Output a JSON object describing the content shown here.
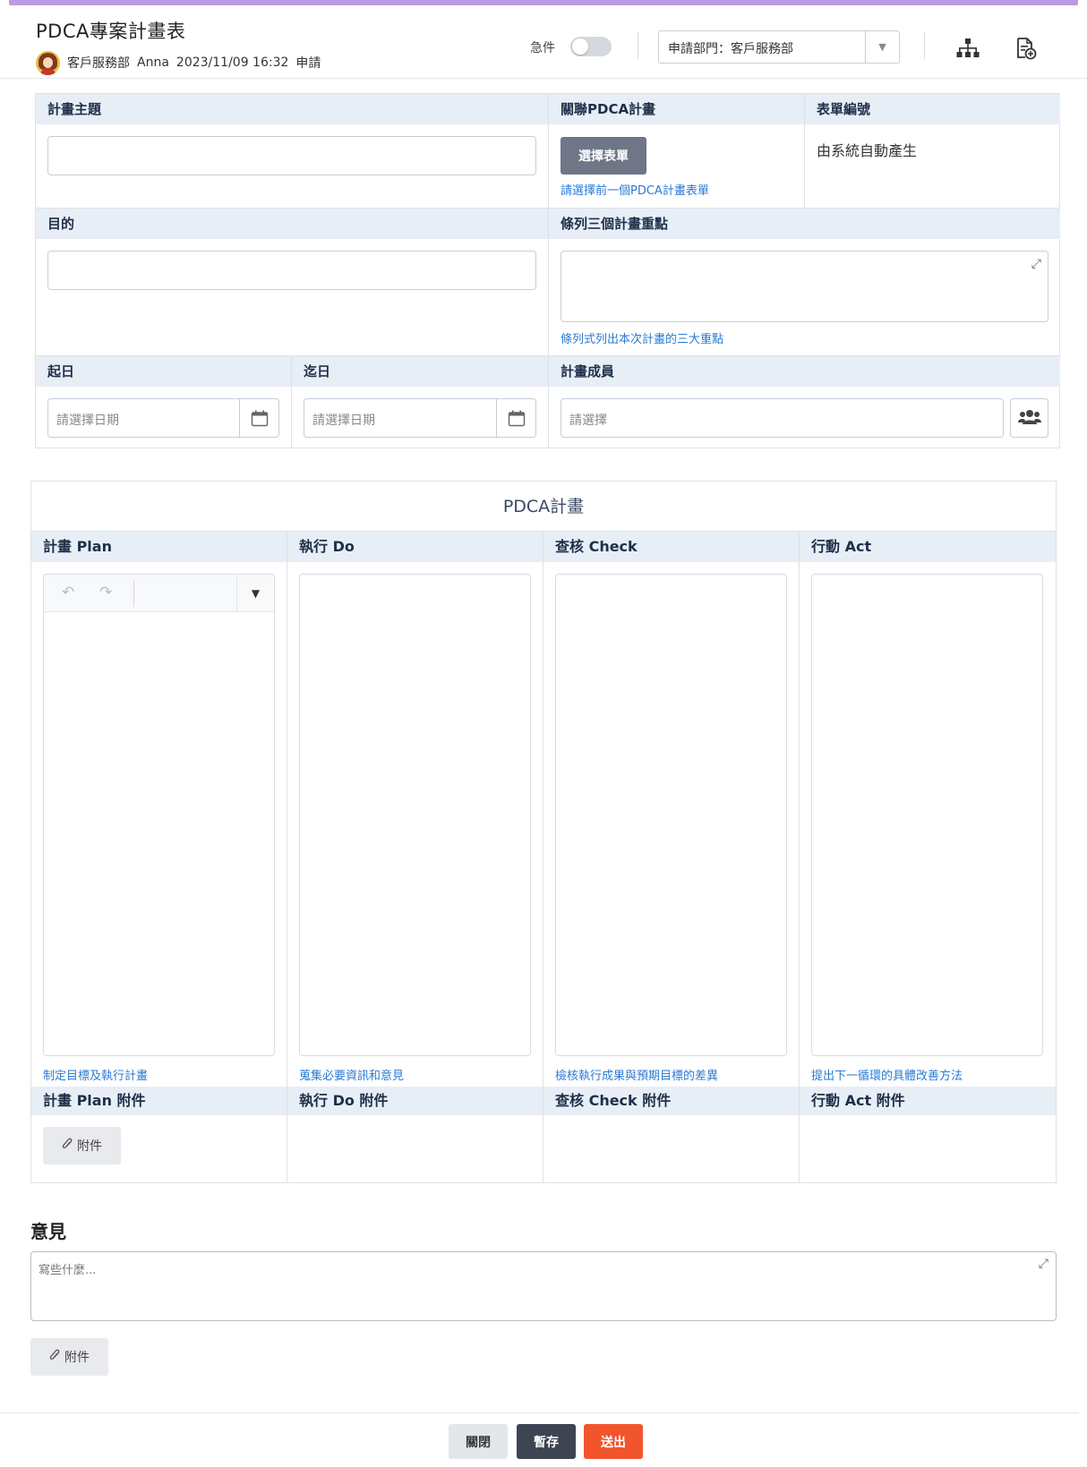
{
  "header": {
    "title": "PDCA專案計畫表",
    "applicant_dept": "客戶服務部",
    "applicant_name": "Anna",
    "date": "2023/11/09 16:32",
    "action": "申請",
    "urgent_label": "急件",
    "urgent_on": false,
    "dept_select_value": "申請部門：客戶服務部"
  },
  "form": {
    "subject_label": "計畫主題",
    "subject_value": "",
    "related_label": "關聯PDCA計畫",
    "select_form_button": "選擇表單",
    "related_hint": "請選擇前一個PDCA計畫表單",
    "form_no_label": "表單編號",
    "form_no_value": "由系統自動產生",
    "purpose_label": "目的",
    "purpose_value": "",
    "key_points_label": "條列三個計畫重點",
    "key_points_hint": "條列式列出本次計畫的三大重點",
    "start_label": "起日",
    "start_placeholder": "請選擇日期",
    "end_label": "迄日",
    "end_placeholder": "請選擇日期",
    "members_label": "計畫成員",
    "members_placeholder": "請選擇"
  },
  "pdca": {
    "title": "PDCA計畫",
    "columns": [
      {
        "label": "計畫 Plan",
        "hint": "制定目標及執行計畫",
        "attach_label": "計畫 Plan 附件",
        "has_attach_button": true
      },
      {
        "label": "執行 Do",
        "hint": "蒐集必要資訊和意見",
        "attach_label": "執行 Do 附件",
        "has_attach_button": false
      },
      {
        "label": "查核 Check",
        "hint": "檢核執行成果與預期目標的差異",
        "attach_label": "查核 Check 附件",
        "has_attach_button": false
      },
      {
        "label": "行動 Act",
        "hint": "提出下一循環的具體改善方法",
        "attach_label": "行動 Act 附件",
        "has_attach_button": false
      }
    ],
    "attach_button": "附件"
  },
  "opinion": {
    "title": "意見",
    "placeholder": "寫些什麼...",
    "attach_button": "附件"
  },
  "footer": {
    "close_label": "關閉",
    "save_label": "暫存",
    "submit_label": "送出"
  },
  "colors": {
    "accent_bar": "#b99be0",
    "header_bg": "#e8eef6",
    "hint": "#2a7ad4",
    "submit": "#f2552c",
    "save": "#3d4452"
  },
  "icons": [
    "org-chart-icon",
    "add-document-icon",
    "calendar-icon",
    "group-icon",
    "expand-icon",
    "paperclip-icon",
    "undo-icon",
    "redo-icon",
    "caret-down-icon"
  ]
}
